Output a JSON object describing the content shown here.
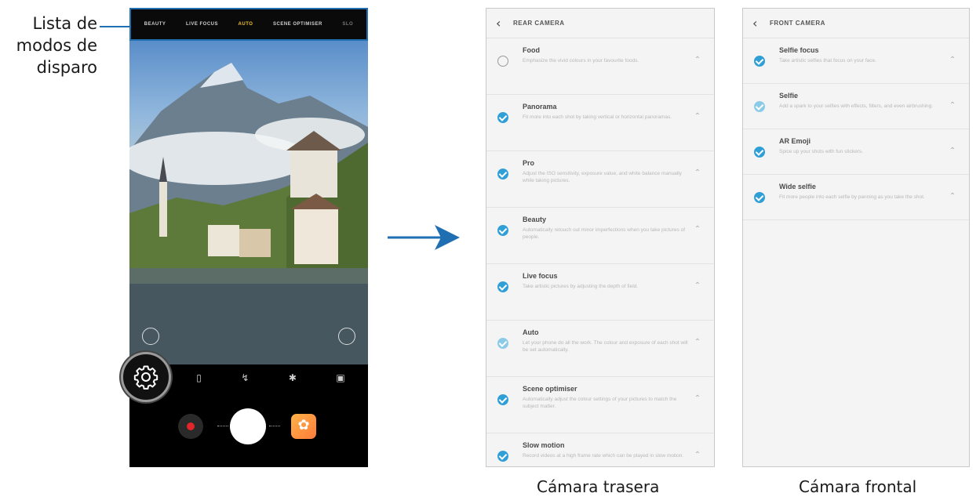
{
  "callout": {
    "label": "Lista de modos de disparo"
  },
  "camera": {
    "modes": [
      "BEAUTY",
      "LIVE FOCUS",
      "AUTO",
      "SCENE OPTIMISER",
      "SLO"
    ],
    "active_mode": "AUTO",
    "accent_color": "#f2c230",
    "settings_icon": "gear-icon"
  },
  "rear_panel": {
    "title": "REAR CAMERA",
    "items": [
      {
        "name": "Food",
        "desc": "Emphasize the vivid colours in your favourite foods.",
        "checked": "empty"
      },
      {
        "name": "Panorama",
        "desc": "Fit more into each shot by taking vertical or horizontal panoramas.",
        "checked": "on"
      },
      {
        "name": "Pro",
        "desc": "Adjust the ISO sensitivity, exposure value, and white balance manually while taking pictures.",
        "checked": "on"
      },
      {
        "name": "Beauty",
        "desc": "Automatically retouch out minor imperfections when you take pictures of people.",
        "checked": "on"
      },
      {
        "name": "Live focus",
        "desc": "Take artistic pictures by adjusting the depth of field.",
        "checked": "on"
      },
      {
        "name": "Auto",
        "desc": "Let your phone do all the work. The colour and exposure of each shot will be set automatically.",
        "checked": "light"
      },
      {
        "name": "Scene optimiser",
        "desc": "Automatically adjust the colour settings of your pictures to match the subject matter.",
        "checked": "on"
      },
      {
        "name": "Slow motion",
        "desc": "Record videos at a high frame rate which can be played in slow motion.",
        "checked": "on"
      }
    ]
  },
  "front_panel": {
    "title": "FRONT CAMERA",
    "items": [
      {
        "name": "Selfie focus",
        "desc": "Take artistic selfies that focus on your face.",
        "checked": "on"
      },
      {
        "name": "Selfie",
        "desc": "Add a spark to your selfies with effects, filters, and even airbrushing.",
        "checked": "light"
      },
      {
        "name": "AR Emoji",
        "desc": "Spice up your shots with fun stickers.",
        "checked": "on"
      },
      {
        "name": "Wide selfie",
        "desc": "Fit more people into each selfie by panning as you take the shot.",
        "checked": "on"
      }
    ]
  },
  "captions": {
    "rear": "Cámara trasera",
    "front": "Cámara frontal"
  },
  "colors": {
    "highlight": "#1f6fb2",
    "check": "#2f9fd6"
  }
}
